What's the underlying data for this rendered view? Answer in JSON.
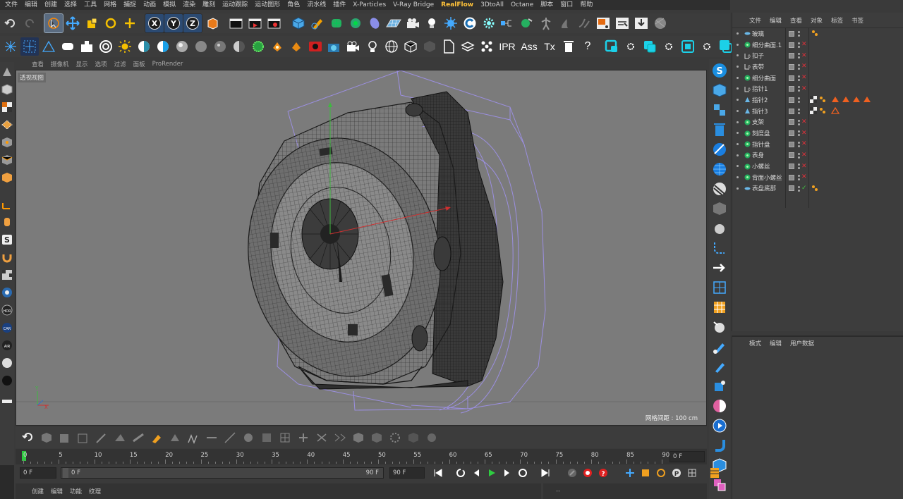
{
  "menubar": {
    "items": [
      "文件",
      "编辑",
      "创建",
      "选择",
      "工具",
      "网格",
      "捕捉",
      "动画",
      "模拟",
      "渲染",
      "雕刻",
      "运动跟踪",
      "运动图形",
      "角色",
      "流水线",
      "插件",
      "X-Particles",
      "V-Ray Bridge",
      "RealFlow",
      "3DtoAll",
      "Octane",
      "脚本",
      "窗口",
      "帮助"
    ],
    "highlighted": "RealFlow"
  },
  "toolbar1": {
    "icons": [
      "undo-icon",
      "redo-icon",
      "live-select-icon",
      "move-icon",
      "scale-icon",
      "rotate-icon",
      "recent-tool-icon",
      "x-axis-icon",
      "y-axis-icon",
      "z-axis-icon",
      "world-coords-icon",
      "render-view-icon",
      "render-picture-viewer-icon",
      "render-settings-icon",
      "cube-icon",
      "pen-icon",
      "subdivision-icon",
      "cloner-icon",
      "deformer-icon",
      "floor-icon",
      "camera-icon",
      "light-icon",
      "sky-icon",
      "octane-icon",
      "settings-gear-icon",
      "tag-icon",
      "paint-icon",
      "figure-icon",
      "realflow-icon",
      "particles-icon",
      "output-icon",
      "script-icon",
      "download-icon",
      "globe-icon"
    ]
  },
  "toolbar2": {
    "text_buttons": {
      "ipr": "IPR",
      "ass": "Ass",
      "tx": "Tx",
      "help": "?"
    }
  },
  "viewport": {
    "menu": [
      "查看",
      "摄像机",
      "显示",
      "选项",
      "过滤",
      "面板",
      "ProRender"
    ],
    "view_name": "透视视图",
    "grid_label": "网格间距 : 100 cm"
  },
  "object_manager": {
    "menu": [
      "文件",
      "编辑",
      "查看",
      "对象",
      "标签",
      "书签"
    ],
    "objects": [
      {
        "name": "玻璃",
        "type": "shape",
        "status": "none",
        "tags": "mat"
      },
      {
        "name": "细分曲面.1",
        "type": "sds",
        "status": "x",
        "tags": ""
      },
      {
        "name": "扣子",
        "type": "null",
        "status": "x",
        "tags": ""
      },
      {
        "name": "表带",
        "type": "null",
        "status": "x",
        "tags": ""
      },
      {
        "name": "细分曲面",
        "type": "sds",
        "status": "x",
        "tags": ""
      },
      {
        "name": "指针1",
        "type": "null",
        "status": "x",
        "tags": ""
      },
      {
        "name": "指针2",
        "type": "joint",
        "status": "none",
        "tags": "tri4"
      },
      {
        "name": "指针3",
        "type": "joint",
        "status": "none",
        "tags": "tri1"
      },
      {
        "name": "支架",
        "type": "sds",
        "status": "x",
        "tags": ""
      },
      {
        "name": "刻度盘",
        "type": "sds",
        "status": "x",
        "tags": ""
      },
      {
        "name": "指针盘",
        "type": "sds",
        "status": "x",
        "tags": ""
      },
      {
        "name": "表身",
        "type": "sds",
        "status": "x",
        "tags": ""
      },
      {
        "name": "小螺丝",
        "type": "sds",
        "status": "x",
        "tags": ""
      },
      {
        "name": "背面小螺丝",
        "type": "sds",
        "status": "x",
        "tags": ""
      },
      {
        "name": "表盘底部",
        "type": "shape",
        "status": "check",
        "tags": "mat"
      }
    ]
  },
  "attribute_manager": {
    "menu": [
      "模式",
      "编辑",
      "用户数据"
    ]
  },
  "timeline": {
    "ticks": [
      "0",
      "5",
      "10",
      "15",
      "20",
      "25",
      "30",
      "35",
      "40",
      "45",
      "50",
      "55",
      "60",
      "65",
      "70",
      "75",
      "80",
      "85",
      "90"
    ],
    "current_frame": "0 F"
  },
  "transport": {
    "start_field": "0 F",
    "range_start": "0 F",
    "range_end": "90 F",
    "end_field": "90 F"
  },
  "material_bar": {
    "menu": [
      "创建",
      "编辑",
      "功能",
      "纹理"
    ]
  },
  "coords": {
    "text": "--"
  },
  "colors": {
    "accent_blue": "#2aa0e0",
    "realflow_orange": "#ffc23a",
    "wire_purple": "#9b8fe0"
  }
}
